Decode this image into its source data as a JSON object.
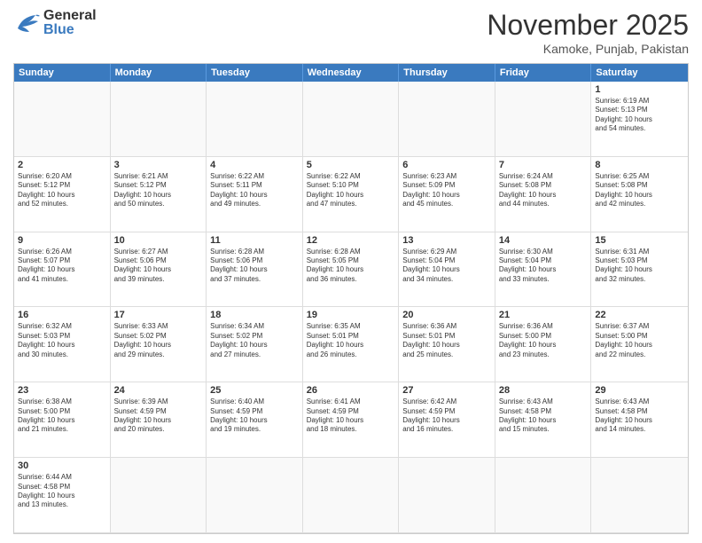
{
  "header": {
    "logo": {
      "general": "General",
      "blue": "Blue"
    },
    "title": "November 2025",
    "location": "Kamoke, Punjab, Pakistan"
  },
  "days": [
    "Sunday",
    "Monday",
    "Tuesday",
    "Wednesday",
    "Thursday",
    "Friday",
    "Saturday"
  ],
  "cells": [
    {
      "num": "",
      "info": "",
      "empty": true
    },
    {
      "num": "",
      "info": "",
      "empty": true
    },
    {
      "num": "",
      "info": "",
      "empty": true
    },
    {
      "num": "",
      "info": "",
      "empty": true
    },
    {
      "num": "",
      "info": "",
      "empty": true
    },
    {
      "num": "",
      "info": "",
      "empty": true
    },
    {
      "num": "1",
      "info": "Sunrise: 6:19 AM\nSunset: 5:13 PM\nDaylight: 10 hours\nand 54 minutes."
    },
    {
      "num": "2",
      "info": "Sunrise: 6:20 AM\nSunset: 5:12 PM\nDaylight: 10 hours\nand 52 minutes."
    },
    {
      "num": "3",
      "info": "Sunrise: 6:21 AM\nSunset: 5:12 PM\nDaylight: 10 hours\nand 50 minutes."
    },
    {
      "num": "4",
      "info": "Sunrise: 6:22 AM\nSunset: 5:11 PM\nDaylight: 10 hours\nand 49 minutes."
    },
    {
      "num": "5",
      "info": "Sunrise: 6:22 AM\nSunset: 5:10 PM\nDaylight: 10 hours\nand 47 minutes."
    },
    {
      "num": "6",
      "info": "Sunrise: 6:23 AM\nSunset: 5:09 PM\nDaylight: 10 hours\nand 45 minutes."
    },
    {
      "num": "7",
      "info": "Sunrise: 6:24 AM\nSunset: 5:08 PM\nDaylight: 10 hours\nand 44 minutes."
    },
    {
      "num": "8",
      "info": "Sunrise: 6:25 AM\nSunset: 5:08 PM\nDaylight: 10 hours\nand 42 minutes."
    },
    {
      "num": "9",
      "info": "Sunrise: 6:26 AM\nSunset: 5:07 PM\nDaylight: 10 hours\nand 41 minutes."
    },
    {
      "num": "10",
      "info": "Sunrise: 6:27 AM\nSunset: 5:06 PM\nDaylight: 10 hours\nand 39 minutes."
    },
    {
      "num": "11",
      "info": "Sunrise: 6:28 AM\nSunset: 5:06 PM\nDaylight: 10 hours\nand 37 minutes."
    },
    {
      "num": "12",
      "info": "Sunrise: 6:28 AM\nSunset: 5:05 PM\nDaylight: 10 hours\nand 36 minutes."
    },
    {
      "num": "13",
      "info": "Sunrise: 6:29 AM\nSunset: 5:04 PM\nDaylight: 10 hours\nand 34 minutes."
    },
    {
      "num": "14",
      "info": "Sunrise: 6:30 AM\nSunset: 5:04 PM\nDaylight: 10 hours\nand 33 minutes."
    },
    {
      "num": "15",
      "info": "Sunrise: 6:31 AM\nSunset: 5:03 PM\nDaylight: 10 hours\nand 32 minutes."
    },
    {
      "num": "16",
      "info": "Sunrise: 6:32 AM\nSunset: 5:03 PM\nDaylight: 10 hours\nand 30 minutes."
    },
    {
      "num": "17",
      "info": "Sunrise: 6:33 AM\nSunset: 5:02 PM\nDaylight: 10 hours\nand 29 minutes."
    },
    {
      "num": "18",
      "info": "Sunrise: 6:34 AM\nSunset: 5:02 PM\nDaylight: 10 hours\nand 27 minutes."
    },
    {
      "num": "19",
      "info": "Sunrise: 6:35 AM\nSunset: 5:01 PM\nDaylight: 10 hours\nand 26 minutes."
    },
    {
      "num": "20",
      "info": "Sunrise: 6:36 AM\nSunset: 5:01 PM\nDaylight: 10 hours\nand 25 minutes."
    },
    {
      "num": "21",
      "info": "Sunrise: 6:36 AM\nSunset: 5:00 PM\nDaylight: 10 hours\nand 23 minutes."
    },
    {
      "num": "22",
      "info": "Sunrise: 6:37 AM\nSunset: 5:00 PM\nDaylight: 10 hours\nand 22 minutes."
    },
    {
      "num": "23",
      "info": "Sunrise: 6:38 AM\nSunset: 5:00 PM\nDaylight: 10 hours\nand 21 minutes."
    },
    {
      "num": "24",
      "info": "Sunrise: 6:39 AM\nSunset: 4:59 PM\nDaylight: 10 hours\nand 20 minutes."
    },
    {
      "num": "25",
      "info": "Sunrise: 6:40 AM\nSunset: 4:59 PM\nDaylight: 10 hours\nand 19 minutes."
    },
    {
      "num": "26",
      "info": "Sunrise: 6:41 AM\nSunset: 4:59 PM\nDaylight: 10 hours\nand 18 minutes."
    },
    {
      "num": "27",
      "info": "Sunrise: 6:42 AM\nSunset: 4:59 PM\nDaylight: 10 hours\nand 16 minutes."
    },
    {
      "num": "28",
      "info": "Sunrise: 6:43 AM\nSunset: 4:58 PM\nDaylight: 10 hours\nand 15 minutes."
    },
    {
      "num": "29",
      "info": "Sunrise: 6:43 AM\nSunset: 4:58 PM\nDaylight: 10 hours\nand 14 minutes."
    },
    {
      "num": "30",
      "info": "Sunrise: 6:44 AM\nSunset: 4:58 PM\nDaylight: 10 hours\nand 13 minutes."
    },
    {
      "num": "",
      "info": "",
      "empty": true
    },
    {
      "num": "",
      "info": "",
      "empty": true
    },
    {
      "num": "",
      "info": "",
      "empty": true
    },
    {
      "num": "",
      "info": "",
      "empty": true
    },
    {
      "num": "",
      "info": "",
      "empty": true
    },
    {
      "num": "",
      "info": "",
      "empty": true
    }
  ]
}
